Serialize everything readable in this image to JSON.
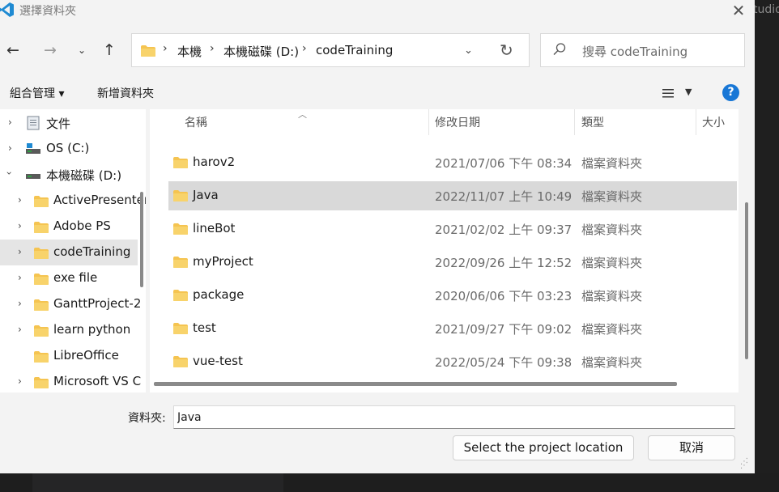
{
  "window": {
    "title": "選擇資料夾",
    "background_text": "tudio"
  },
  "nav": {
    "path": [
      "本機",
      "本機磁碟 (D:)",
      "codeTraining"
    ]
  },
  "search": {
    "placeholder": "搜尋 codeTraining"
  },
  "commands": {
    "organize": "組合管理 ▾",
    "new_folder": "新增資料夾"
  },
  "tree": {
    "items": [
      {
        "label": "文件",
        "icon": "documents-icon",
        "expanded": false
      },
      {
        "label": "OS (C:)",
        "icon": "drive-icon",
        "expanded": false
      },
      {
        "label": "本機磁碟 (D:)",
        "icon": "drive-icon",
        "expanded": true
      },
      {
        "label": "ActivePresenter",
        "icon": "folder-icon",
        "expanded": false
      },
      {
        "label": "Adobe PS",
        "icon": "folder-icon",
        "expanded": false
      },
      {
        "label": "codeTraining",
        "icon": "folder-icon",
        "expanded": false,
        "selected": true
      },
      {
        "label": "exe file",
        "icon": "folder-icon",
        "expanded": false
      },
      {
        "label": "GanttProject-2",
        "icon": "folder-icon",
        "expanded": false
      },
      {
        "label": "learn python",
        "icon": "folder-icon",
        "expanded": false
      },
      {
        "label": "LibreOffice",
        "icon": "folder-icon",
        "expanded": false
      },
      {
        "label": "Microsoft VS C",
        "icon": "folder-icon",
        "expanded": false
      }
    ]
  },
  "list": {
    "columns": {
      "name": "名稱",
      "modified": "修改日期",
      "type": "類型",
      "size": "大小"
    },
    "rows": [
      {
        "name": "harov2",
        "date": "2021/07/06 下午 08:34",
        "type": "檔案資料夾"
      },
      {
        "name": "Java",
        "date": "2022/11/07 上午 10:49",
        "type": "檔案資料夾",
        "selected": true
      },
      {
        "name": "lineBot",
        "date": "2021/02/02 上午 09:37",
        "type": "檔案資料夾"
      },
      {
        "name": "myProject",
        "date": "2022/09/26 上午 12:52",
        "type": "檔案資料夾"
      },
      {
        "name": "package",
        "date": "2020/06/06 下午 03:23",
        "type": "檔案資料夾"
      },
      {
        "name": "test",
        "date": "2021/09/27 下午 09:02",
        "type": "檔案資料夾"
      },
      {
        "name": "vue-test",
        "date": "2022/05/24 下午 09:38",
        "type": "檔案資料夾"
      }
    ]
  },
  "footer": {
    "folder_label": "資料夾:",
    "folder_value": "Java",
    "select_button": "Select the project location",
    "cancel_button": "取消"
  },
  "colors": {
    "accent": "#1877d6",
    "folder": "#f5c451",
    "selected_row": "#d9d9d9"
  }
}
